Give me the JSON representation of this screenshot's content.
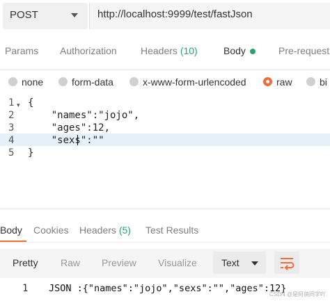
{
  "request": {
    "method": "POST",
    "url": "http://localhost:9999/test/fastJson"
  },
  "request_tabs": [
    {
      "label": "Params"
    },
    {
      "label": "Authorization"
    },
    {
      "label": "Headers",
      "count": "(10)"
    },
    {
      "label": "Body"
    },
    {
      "label": "Pre-request"
    }
  ],
  "body_types": [
    "none",
    "form-data",
    "x-www-form-urlencoded",
    "raw",
    "bi"
  ],
  "body_type_selected": "raw",
  "editor": {
    "line_numbers": [
      "1",
      "2",
      "3",
      "4",
      "5"
    ],
    "lines": [
      "{",
      "    \"names\":\"jojo\",",
      "    \"ages\":12,",
      "    \"sexs\":\"\"",
      "}"
    ],
    "active_line": "4"
  },
  "response_tabs": [
    {
      "label": "Body"
    },
    {
      "label": "Cookies"
    },
    {
      "label": "Headers",
      "count": "(5)"
    },
    {
      "label": "Test Results"
    }
  ],
  "response_view_modes": [
    "Pretty",
    "Raw",
    "Preview",
    "Visualize"
  ],
  "response_view_selected": "Pretty",
  "response_format": "Text",
  "response_body": {
    "line_number": "1",
    "text": "JSON :{\"names\":\"jojo\",\"sexs\":\"\",\"ages\":12}"
  },
  "watermark": "CSDN @是阿俏同学吖",
  "colors": {
    "accent": "#f26b3a",
    "count_green": "#27a46e"
  }
}
